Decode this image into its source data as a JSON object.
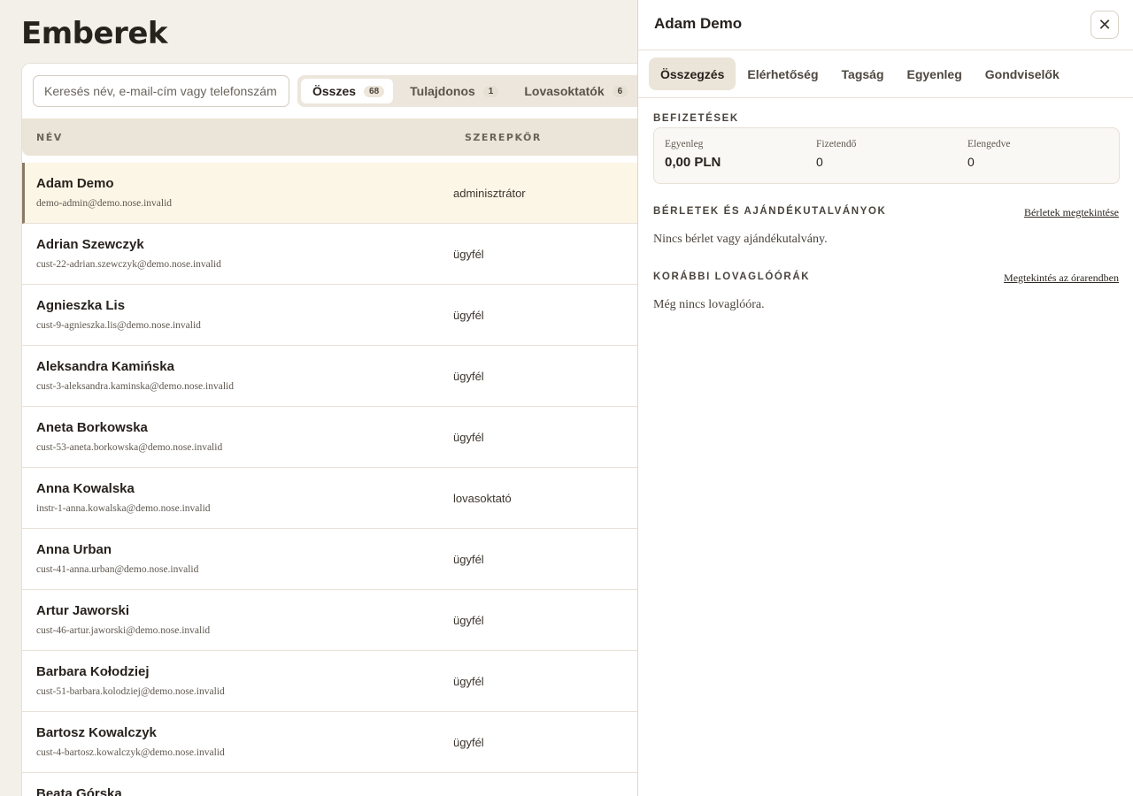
{
  "page": {
    "title": "Emberek"
  },
  "search": {
    "placeholder": "Keresés név, e-mail-cím vagy telefonszám"
  },
  "filters": [
    {
      "label": "Összes",
      "count": "68"
    },
    {
      "label": "Tulajdonos",
      "count": "1"
    },
    {
      "label": "Lovasoktatók",
      "count": "6"
    }
  ],
  "table": {
    "headers": {
      "name": "NÉV",
      "role": "SZEREPKÖR"
    },
    "rows": [
      {
        "name": "Adam Demo",
        "email": "demo-admin@demo.nose.invalid",
        "role": "adminisztrátor"
      },
      {
        "name": "Adrian Szewczyk",
        "email": "cust-22-adrian.szewczyk@demo.nose.invalid",
        "role": "ügyfél"
      },
      {
        "name": "Agnieszka Lis",
        "email": "cust-9-agnieszka.lis@demo.nose.invalid",
        "role": "ügyfél"
      },
      {
        "name": "Aleksandra Kamińska",
        "email": "cust-3-aleksandra.kaminska@demo.nose.invalid",
        "role": "ügyfél"
      },
      {
        "name": "Aneta Borkowska",
        "email": "cust-53-aneta.borkowska@demo.nose.invalid",
        "role": "ügyfél"
      },
      {
        "name": "Anna Kowalska",
        "email": "instr-1-anna.kowalska@demo.nose.invalid",
        "role": "lovasoktató"
      },
      {
        "name": "Anna Urban",
        "email": "cust-41-anna.urban@demo.nose.invalid",
        "role": "ügyfél"
      },
      {
        "name": "Artur Jaworski",
        "email": "cust-46-artur.jaworski@demo.nose.invalid",
        "role": "ügyfél"
      },
      {
        "name": "Barbara Kołodziej",
        "email": "cust-51-barbara.kolodziej@demo.nose.invalid",
        "role": "ügyfél"
      },
      {
        "name": "Bartosz Kowalczyk",
        "email": "cust-4-bartosz.kowalczyk@demo.nose.invalid",
        "role": "ügyfél"
      },
      {
        "name": "Beata Górska",
        "email": "",
        "role": ""
      }
    ]
  },
  "drawer": {
    "title": "Adam Demo",
    "close_icon": "close-icon",
    "tabs": [
      "Összegzés",
      "Elérhetőség",
      "Tagság",
      "Egyenleg",
      "Gondviselők"
    ],
    "payments": {
      "heading": "BEFIZETÉSEK",
      "balance_label": "Egyenleg",
      "balance_value": "0,00 PLN",
      "due_label": "Fizetendő",
      "due_value": "0",
      "waived_label": "Elengedve",
      "waived_value": "0"
    },
    "passes": {
      "heading": "BÉRLETEK ÉS AJÁNDÉKUTALVÁNYOK",
      "link": "Bérletek megtekintése",
      "empty": "Nincs bérlet vagy ajándékutalvány."
    },
    "lessons": {
      "heading": "KORÁBBI LOVAGLÓÓRÁK",
      "link": "Megtekintés az órarendben",
      "empty": "Még nincs lovaglóóra."
    }
  }
}
